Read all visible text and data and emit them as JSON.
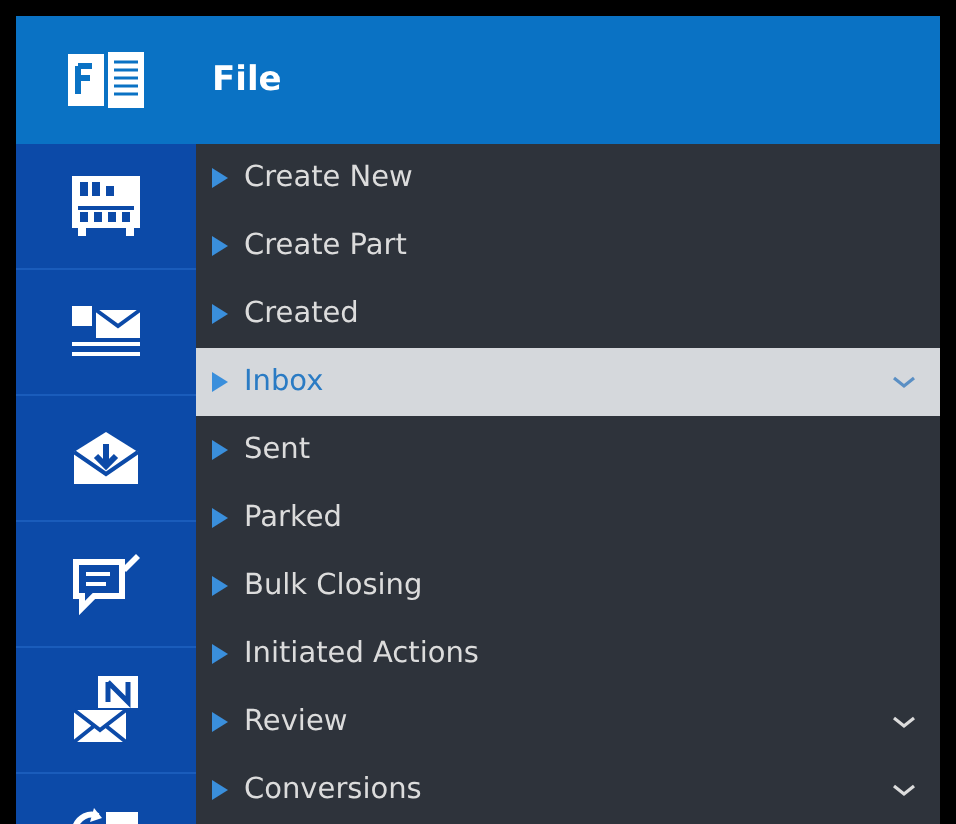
{
  "header": {
    "title": "File"
  },
  "menu": [
    {
      "label": "Create New",
      "expandable": false,
      "selected": false
    },
    {
      "label": "Create Part",
      "expandable": false,
      "selected": false
    },
    {
      "label": "Created",
      "expandable": false,
      "selected": false
    },
    {
      "label": "Inbox",
      "expandable": true,
      "selected": true
    },
    {
      "label": "Sent",
      "expandable": false,
      "selected": false
    },
    {
      "label": "Parked",
      "expandable": false,
      "selected": false
    },
    {
      "label": "Bulk Closing",
      "expandable": false,
      "selected": false
    },
    {
      "label": "Initiated Actions",
      "expandable": false,
      "selected": false
    },
    {
      "label": "Review",
      "expandable": true,
      "selected": false
    },
    {
      "label": "Conversions",
      "expandable": true,
      "selected": false
    }
  ],
  "side_icons": [
    {
      "kind": "cabinet"
    },
    {
      "kind": "dmail"
    },
    {
      "kind": "inbox"
    },
    {
      "kind": "chat"
    },
    {
      "kind": "nmail"
    },
    {
      "kind": "convert"
    }
  ]
}
